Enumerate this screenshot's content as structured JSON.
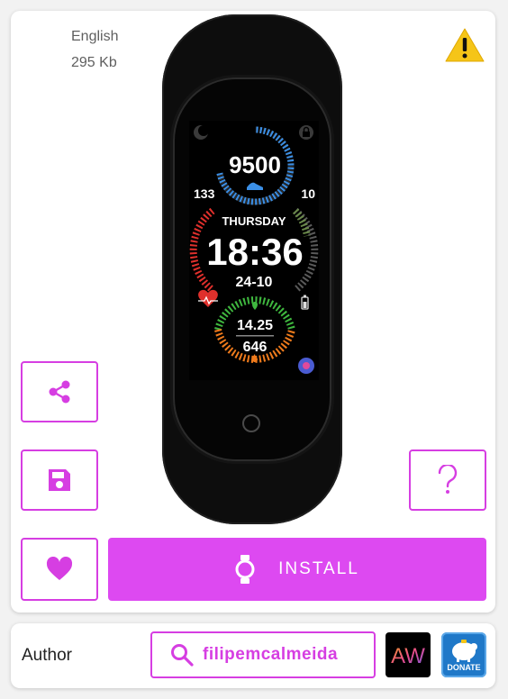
{
  "details": {
    "language": "English",
    "size": "295 Kb"
  },
  "watchface": {
    "steps": "9500",
    "left_value": "133",
    "right_value": "10",
    "weekday": "THURSDAY",
    "time": "18:36",
    "date": "24-10",
    "distance": "14.25",
    "calories": "646"
  },
  "actions": {
    "install_label": "INSTALL"
  },
  "author": {
    "label": "Author",
    "name": "filipemcalmeida",
    "logo_text": "AW",
    "donate_label": "DONATE"
  },
  "colors": {
    "accent": "#dd49f1",
    "accent_border": "#d63ee2",
    "warning": "#f5c518",
    "ring_blue": "#3b8fe6",
    "ring_red": "#e0302c",
    "ring_green": "#3fb83f",
    "ring_orange": "#f07b1c"
  },
  "icons": [
    "warning-icon",
    "share-icon",
    "save-icon",
    "help-icon",
    "heart-icon",
    "watch-icon",
    "search-icon"
  ]
}
